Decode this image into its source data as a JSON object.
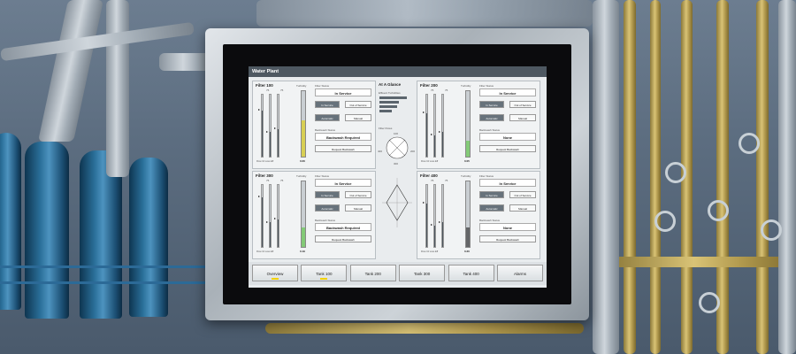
{
  "screen": {
    "title": "Water Plant",
    "filters": [
      {
        "id": "f100",
        "title": "Filter 100",
        "turbidity_label": "Turbidity",
        "turbidity_value": "0.06",
        "turbidity_level": 0.55,
        "turbidity_color": "#e3d000",
        "bars": [
          {
            "level": 0.75
          },
          {
            "level": 0.4
          },
          {
            "level": 0.45
          }
        ],
        "bar_tops": [
          "75",
          "75"
        ],
        "bar_foot": "Flow  Inf  Loss  Eff",
        "status_label": "Filter Status",
        "status": "In Service",
        "in_service": "In Service",
        "out_of_service": "Out of Service",
        "automatic": "Automatic",
        "manual": "Manual",
        "backwash_label": "Backwash Status",
        "backwash": "Backwash Required",
        "request": "Request Backwash",
        "in_service_on": true,
        "automatic_on": true
      },
      {
        "id": "f200",
        "title": "Filter 200",
        "turbidity_label": "Turbidity",
        "turbidity_value": "0.05",
        "turbidity_level": 0.25,
        "turbidity_color": "#55c83a",
        "bars": [
          {
            "level": 0.7
          },
          {
            "level": 0.35
          },
          {
            "level": 0.4
          }
        ],
        "bar_tops": [
          "75",
          "75"
        ],
        "bar_foot": "Flow  Inf  Loss  Eff",
        "status_label": "Filter Status",
        "status": "In Service",
        "in_service": "In Service",
        "out_of_service": "Out of Service",
        "automatic": "Automatic",
        "manual": "Manual",
        "backwash_label": "Backwash Status",
        "backwash": "None",
        "request": "Request Backwash",
        "in_service_on": true,
        "automatic_on": true
      },
      {
        "id": "f300",
        "title": "Filter 300",
        "turbidity_label": "Turbidity",
        "turbidity_value": "0.19",
        "turbidity_level": 0.3,
        "turbidity_color": "#55c83a",
        "bars": [
          {
            "level": 0.8
          },
          {
            "level": 0.4
          },
          {
            "level": 0.45
          }
        ],
        "bar_tops": [
          "75",
          "75"
        ],
        "bar_foot": "Flow  Inf  Loss  Eff",
        "status_label": "Filter Status",
        "status": "In Service",
        "in_service": "In Service",
        "out_of_service": "Out of Service",
        "automatic": "Automatic",
        "manual": "Manual",
        "backwash_label": "Backwash Status",
        "backwash": "Backwash Required",
        "request": "Request Backwash",
        "in_service_on": true,
        "automatic_on": true
      },
      {
        "id": "f400",
        "title": "Filter 400",
        "turbidity_label": "Turbidity",
        "turbidity_value": "0.20",
        "turbidity_level": 0.3,
        "turbidity_color": "#222222",
        "bars": [
          {
            "level": 0.7
          },
          {
            "level": 0.35
          },
          {
            "level": 0.4
          }
        ],
        "bar_tops": [
          "75",
          "75"
        ],
        "bar_foot": "Flow  Inf  Loss  Eff",
        "status_label": "Filter Status",
        "status": "In Service",
        "in_service": "In Service",
        "out_of_service": "Out of Service",
        "automatic": "Automatic",
        "manual": "Manual",
        "backwash_label": "Backwash Status",
        "backwash": "None",
        "request": "Request Backwash",
        "in_service_on": true,
        "automatic_on": true
      }
    ],
    "glance": {
      "title": "At A Glance",
      "effluent_label": "Effluent Turbidities",
      "flows_label": "Filter Flows",
      "flow_top": "100",
      "flow_left": "400",
      "flow_right": "200",
      "flow_bottom": "300",
      "effluent_levels": [
        0.85,
        0.6,
        0.55,
        0.4
      ]
    },
    "nav": [
      "Overview",
      "Tank 100",
      "Tank 200",
      "Tank 300",
      "Tank 400",
      "Alarms"
    ],
    "nav_active": [
      0,
      1
    ]
  }
}
